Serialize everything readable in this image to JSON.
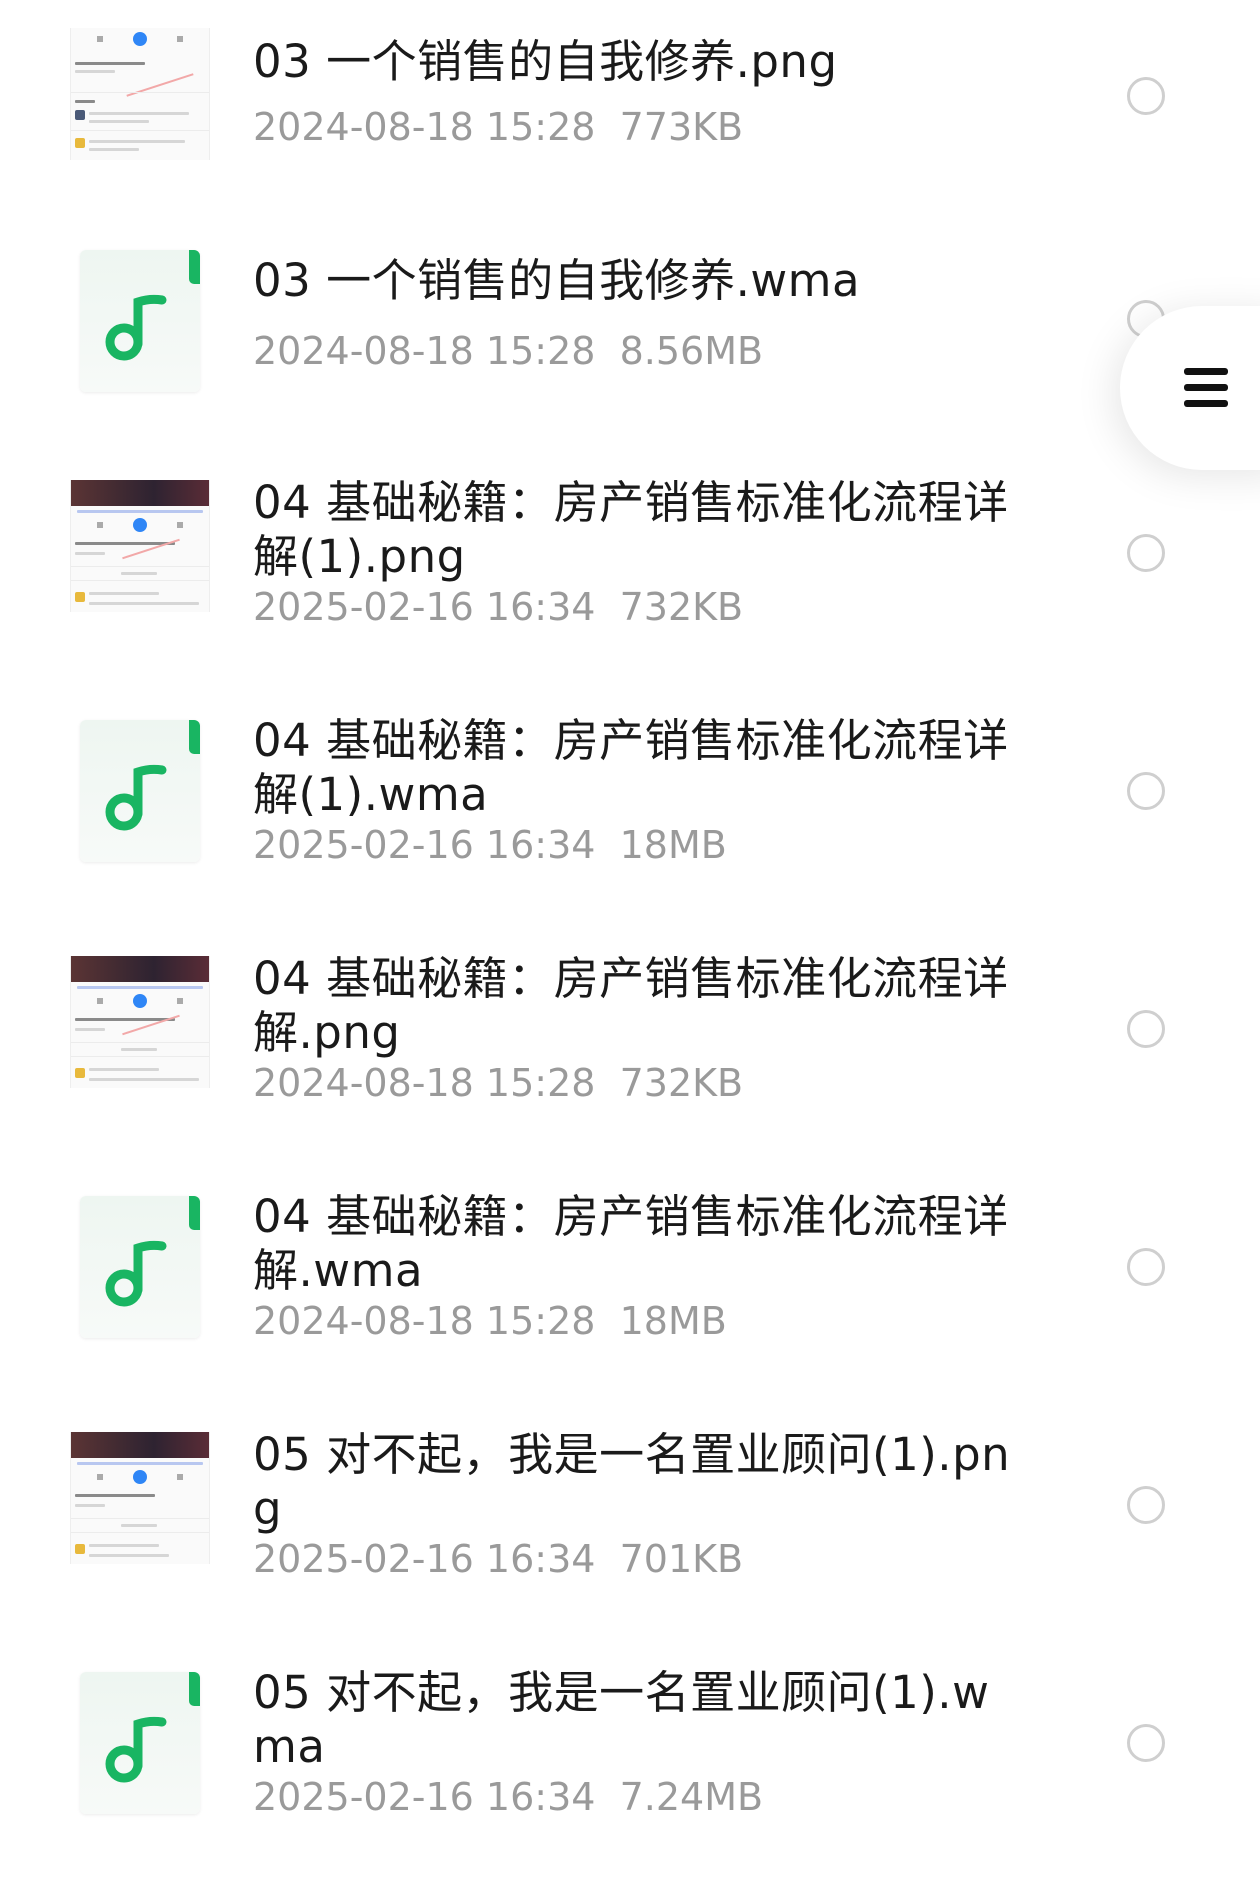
{
  "files": [
    {
      "name": "03 一个销售的自我修养.png",
      "date": "2024-08-18 15:28",
      "size": "773KB",
      "type": "png"
    },
    {
      "name": "03 一个销售的自我修养.wma",
      "date": "2024-08-18 15:28",
      "size": "8.56MB",
      "type": "audio"
    },
    {
      "name": "04 基础秘籍：房产销售标准化流程详解(1).png",
      "date": "2025-02-16 16:34",
      "size": "732KB",
      "type": "png"
    },
    {
      "name": "04 基础秘籍：房产销售标准化流程详解(1).wma",
      "date": "2025-02-16 16:34",
      "size": "18MB",
      "type": "audio"
    },
    {
      "name": "04 基础秘籍：房产销售标准化流程详解.png",
      "date": "2024-08-18 15:28",
      "size": "732KB",
      "type": "png"
    },
    {
      "name": "04 基础秘籍：房产销售标准化流程详解.wma",
      "date": "2024-08-18 15:28",
      "size": "18MB",
      "type": "audio"
    },
    {
      "name": "05 对不起，我是一名置业顾问(1).png",
      "date": "2025-02-16 16:34",
      "size": "701KB",
      "type": "png"
    },
    {
      "name": "05 对不起，我是一名置业顾问(1).wma",
      "date": "2025-02-16 16:34",
      "size": "7.24MB",
      "type": "audio"
    }
  ],
  "colors": {
    "audio_accent": "#19b562",
    "meta_text": "#9a9a9a",
    "radio_border": "#cfcfcf"
  },
  "icons": {
    "audio": "music-note-icon",
    "menu": "menu-icon",
    "select": "radio-button"
  }
}
